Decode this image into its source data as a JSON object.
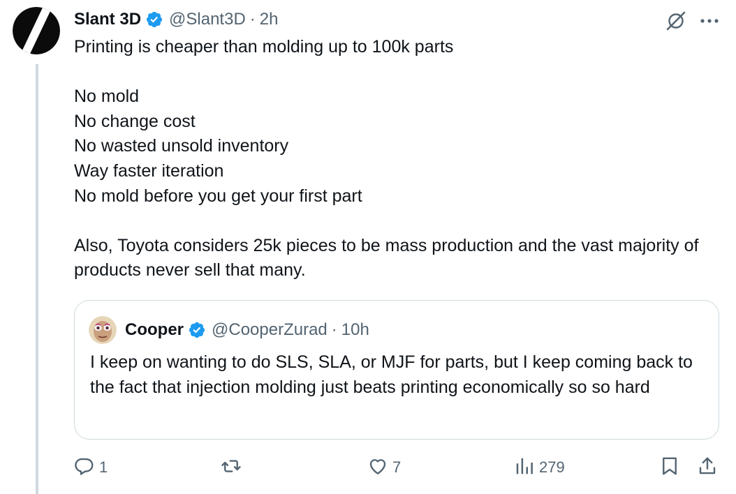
{
  "tweet": {
    "display_name": "Slant 3D",
    "handle": "@Slant3D",
    "separator": "·",
    "time": "2h",
    "text": "Printing is cheaper than molding up to 100k parts\n\nNo mold\nNo change cost\nNo wasted unsold inventory\nWay faster iteration\nNo mold before you get your first part\n\nAlso, Toyota considers 25k pieces to be mass production and the vast majority of products never sell that many."
  },
  "quote": {
    "display_name": "Cooper",
    "handle": "@CooperZurad",
    "separator": "·",
    "time": "10h",
    "text": "I keep on wanting to do SLS, SLA, or MJF for parts, but I keep coming back to the fact that injection molding just beats printing economically so so hard"
  },
  "actions": {
    "replies": "1",
    "reposts": "",
    "likes": "7",
    "views": "279"
  },
  "colors": {
    "verified_blue": "#1d9bf0",
    "icon_gray": "#536471",
    "text": "#0f1419",
    "border": "#cfd9de"
  },
  "icons": [
    "avatar-logo",
    "verified-badge-icon",
    "grok-icon",
    "more-icon",
    "reply-icon",
    "repost-icon",
    "like-icon",
    "views-icon",
    "bookmark-icon",
    "share-icon"
  ]
}
